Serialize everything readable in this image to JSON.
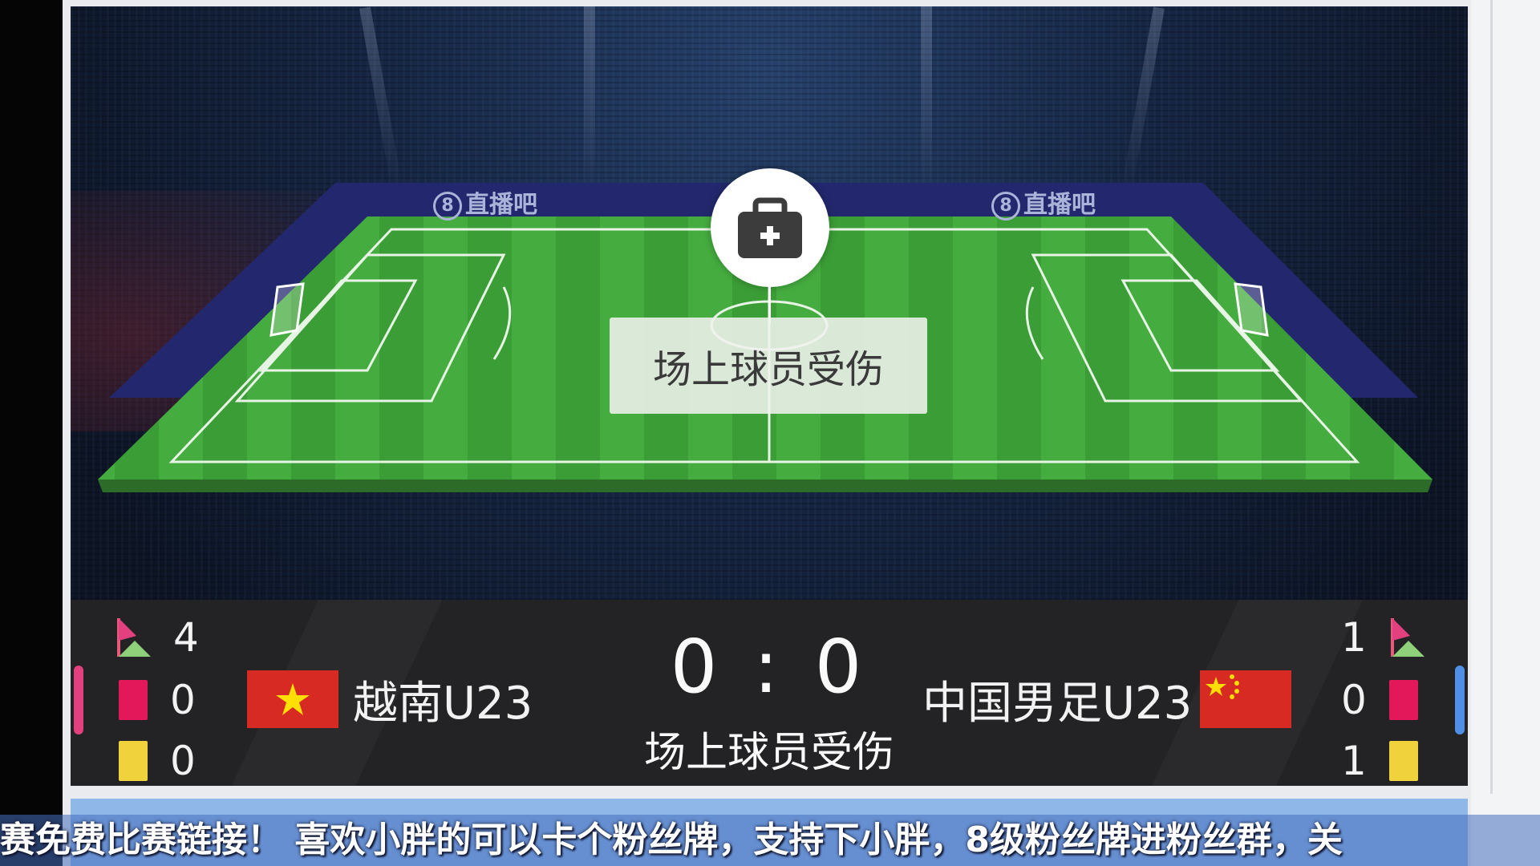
{
  "pitch": {
    "ad_boards": [
      "直播吧",
      "直播吧"
    ],
    "ad_board_number": "8",
    "event_icon": "medical-kit-icon",
    "event_label": "场上球员受伤"
  },
  "score": {
    "home": "0",
    "separator": ":",
    "away": "0",
    "status": "场上球员受伤"
  },
  "home": {
    "name": "越南U23",
    "flag": "vietnam-flag",
    "corners": "4",
    "red_cards": "0",
    "yellow_cards": "0",
    "accent": "#e2407e"
  },
  "away": {
    "name": "中国男足U23",
    "flag": "china-flag",
    "corners": "1",
    "red_cards": "0",
    "yellow_cards": "1",
    "accent": "#4f8fe6"
  },
  "colors": {
    "red_card": "#e2185a",
    "yellow_card": "#f0d23c",
    "pitch_green": "#3fa63a"
  },
  "ticker": {
    "text": "赛免费比赛链接！ 喜欢小胖的可以卡个粉丝牌，支持下小胖，8级粉丝牌进粉丝群，关"
  }
}
